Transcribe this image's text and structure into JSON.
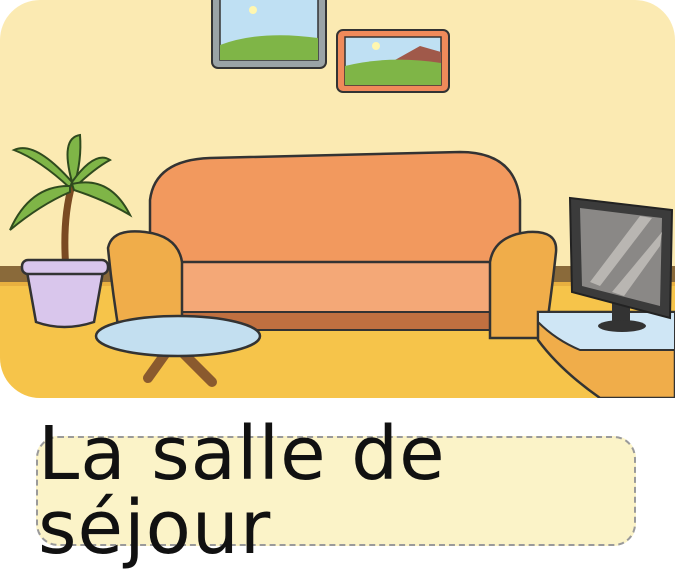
{
  "caption": "La salle de séjour",
  "colors": {
    "wall": "#fbeab2",
    "floor": "#f6c44a",
    "baseboard": "#8a6a3a",
    "sofa": "#f2995e",
    "sofa_arm": "#f0ad4a",
    "pot": "#d9c6ec",
    "table_top": "#c3dff0",
    "tv_stand": "#f0ad4a",
    "tv_stand_top": "#cfe6f5",
    "frame_gray": "#9aa3a6",
    "frame_orange": "#ef8a5a",
    "leaf": "#7fb547"
  },
  "icons": [
    "picture-frame-icon",
    "plant-icon",
    "sofa-icon",
    "coffee-table-icon",
    "television-icon"
  ]
}
